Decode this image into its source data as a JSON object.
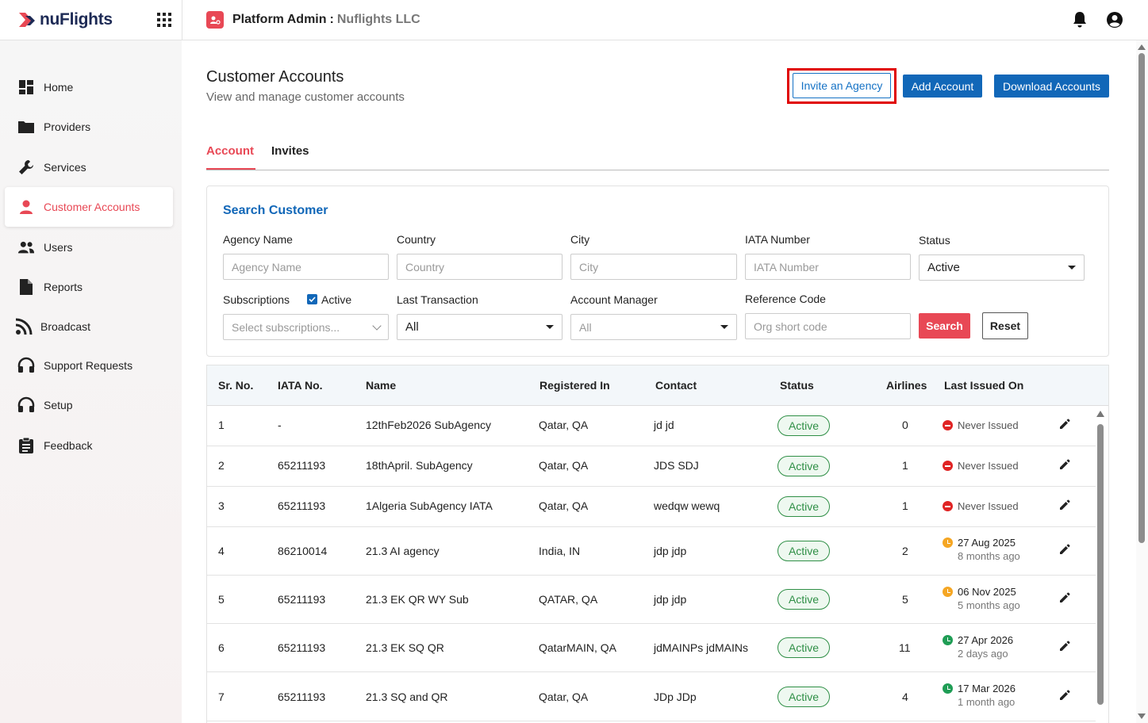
{
  "app": {
    "logo_text": "nuFlights",
    "platform_title": "Platform Admin",
    "platform_sep": ":",
    "platform_org": "Nuflights LLC"
  },
  "sidebar": {
    "items": [
      {
        "label": "Home",
        "icon": "dashboard-icon"
      },
      {
        "label": "Providers",
        "icon": "folder-icon"
      },
      {
        "label": "Services",
        "icon": "wrench-icon"
      },
      {
        "label": "Customer Accounts",
        "icon": "person-icon",
        "active": true
      },
      {
        "label": "Users",
        "icon": "users-icon"
      },
      {
        "label": "Reports",
        "icon": "document-icon"
      },
      {
        "label": "Broadcast",
        "icon": "rss-icon"
      },
      {
        "label": "Support Requests",
        "icon": "headset-icon"
      },
      {
        "label": "Setup",
        "icon": "headset-icon"
      },
      {
        "label": "Feedback",
        "icon": "clipboard-icon"
      }
    ]
  },
  "page": {
    "title": "Customer Accounts",
    "subtitle": "View and manage customer accounts",
    "invite_label": "Invite an Agency",
    "add_label": "Add Account",
    "download_label": "Download Accounts"
  },
  "tabs": {
    "account": "Account",
    "invites": "Invites"
  },
  "search": {
    "title": "Search Customer",
    "agency_label": "Agency Name",
    "agency_placeholder": "Agency Name",
    "country_label": "Country",
    "country_placeholder": "Country",
    "city_label": "City",
    "city_placeholder": "City",
    "iata_label": "IATA Number",
    "iata_placeholder": "IATA Number",
    "status_label": "Status",
    "status_value": "Active",
    "subscriptions_label": "Subscriptions",
    "active_checkbox_label": "Active",
    "subscriptions_placeholder": "Select subscriptions...",
    "last_tx_label": "Last Transaction",
    "last_tx_value": "All",
    "manager_label": "Account Manager",
    "manager_value": "All",
    "refcode_label": "Reference Code",
    "refcode_placeholder": "Org short code",
    "search_label": "Search",
    "reset_label": "Reset"
  },
  "table": {
    "headers": [
      "Sr. No.",
      "IATA No.",
      "Name",
      "Registered In",
      "Contact",
      "Status",
      "Airlines",
      "Last Issued On"
    ],
    "rows": [
      {
        "sr": "1",
        "iata": "-",
        "name": "12thFeb2026 SubAgency",
        "registered": "Qatar, QA",
        "contact": "jd jd",
        "status": "Active",
        "airlines": "0",
        "issued": "Never Issued",
        "issued_sub": "",
        "issued_state": "red"
      },
      {
        "sr": "2",
        "iata": "65211193",
        "name": "18thApril. SubAgency",
        "registered": "Qatar, QA",
        "contact": "JDS SDJ",
        "status": "Active",
        "airlines": "1",
        "issued": "Never Issued",
        "issued_sub": "",
        "issued_state": "red"
      },
      {
        "sr": "3",
        "iata": "65211193",
        "name": "1Algeria SubAgency IATA",
        "registered": "Qatar, QA",
        "contact": "wedqw wewq",
        "status": "Active",
        "airlines": "1",
        "issued": "Never Issued",
        "issued_sub": "",
        "issued_state": "red"
      },
      {
        "sr": "4",
        "iata": "86210014",
        "name": "21.3 AI agency",
        "registered": "India, IN",
        "contact": "jdp jdp",
        "status": "Active",
        "airlines": "2",
        "issued": "27 Aug 2025",
        "issued_sub": "8 months ago",
        "issued_state": "orange"
      },
      {
        "sr": "5",
        "iata": "65211193",
        "name": "21.3 EK QR WY Sub",
        "registered": "QATAR, QA",
        "contact": "jdp jdp",
        "status": "Active",
        "airlines": "5",
        "issued": "06 Nov 2025",
        "issued_sub": "5 months ago",
        "issued_state": "orange"
      },
      {
        "sr": "6",
        "iata": "65211193",
        "name": "21.3 EK SQ QR",
        "registered": "QatarMAIN, QA",
        "contact": "jdMAINPs jdMAINs",
        "status": "Active",
        "airlines": "11",
        "issued": "27 Apr 2026",
        "issued_sub": "2 days ago",
        "issued_state": "green"
      },
      {
        "sr": "7",
        "iata": "65211193",
        "name": "21.3 SQ and QR",
        "registered": "Qatar, QA",
        "contact": "JDp JDp",
        "status": "Active",
        "airlines": "4",
        "issued": "17 Mar 2026",
        "issued_sub": "1 month ago",
        "issued_state": "green"
      }
    ]
  },
  "colors": {
    "brand_red": "#e84855",
    "primary_blue": "#1167b8",
    "active_green": "#2f8f46",
    "highlight_red": "#e00000"
  }
}
